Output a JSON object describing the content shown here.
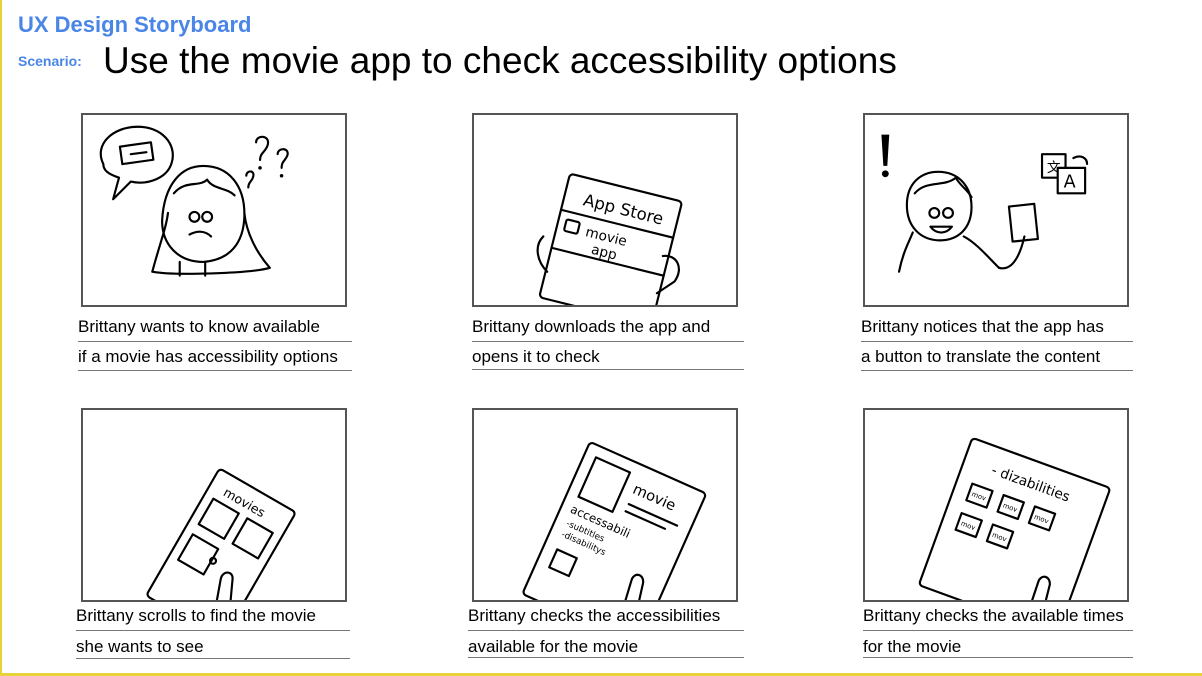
{
  "header": {
    "title": "UX Design Storyboard",
    "scenario_label": "Scenario:",
    "scenario": "Use the movie app to check accessibility options"
  },
  "panels": [
    {
      "caption": [
        "Brittany wants to know available",
        "if a movie has accessibility options"
      ]
    },
    {
      "caption": [
        "Brittany downloads the app and",
        "opens it to check"
      ],
      "sketch_text": {
        "store": "App Store",
        "app_line1": "movie",
        "app_line2": "app"
      }
    },
    {
      "caption": [
        "Brittany notices that the app has",
        "a button to translate the content"
      ],
      "sketch_text": {
        "translate_a": "A",
        "translate_b": "文"
      }
    },
    {
      "caption": [
        "Brittany scrolls to find the movie",
        "she wants to see"
      ],
      "sketch_text": {
        "list_title": "movies"
      }
    },
    {
      "caption": [
        "Brittany checks the accessibilities",
        "available for the movie"
      ],
      "sketch_text": {
        "title": "movie",
        "heading": "accessabili",
        "item1": "-subtitles",
        "item2": "-disabilitys"
      }
    },
    {
      "caption": [
        "Brittany checks the available times",
        "for the movie"
      ],
      "sketch_text": {
        "heading": "- dizabilities",
        "slot": "mov"
      }
    }
  ]
}
